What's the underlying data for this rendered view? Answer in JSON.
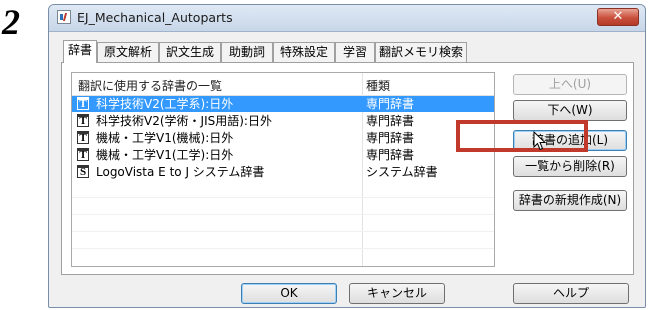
{
  "step_number": "2",
  "window": {
    "title": "EJ_Mechanical_Autoparts",
    "close_glyph": "✕"
  },
  "tabs": [
    {
      "label": "辞書",
      "active": true
    },
    {
      "label": "原文解析",
      "active": false
    },
    {
      "label": "訳文生成",
      "active": false
    },
    {
      "label": "助動詞",
      "active": false
    },
    {
      "label": "特殊設定",
      "active": false
    },
    {
      "label": "学習",
      "active": false
    },
    {
      "label": "翻訳メモリ検索",
      "active": false
    }
  ],
  "dictionary_list": {
    "columns": [
      "翻訳に使用する辞書の一覧",
      "種類"
    ],
    "rows": [
      {
        "icon": "T",
        "name": "科学技術V2(工学系):日外",
        "type": "専門辞書",
        "selected": true
      },
      {
        "icon": "T",
        "name": "科学技術V2(学術・JIS用語):日外",
        "type": "専門辞書",
        "selected": false
      },
      {
        "icon": "T",
        "name": "機械・工学V1(機械):日外",
        "type": "専門辞書",
        "selected": false
      },
      {
        "icon": "T",
        "name": "機械・工学V1(工学):日外",
        "type": "専門辞書",
        "selected": false
      },
      {
        "icon": "S",
        "name": "LogoVista E to J システム辞書",
        "type": "システム辞書",
        "selected": false
      }
    ]
  },
  "side_buttons": {
    "move_up": "上へ(U)",
    "move_down": "下へ(W)",
    "add_dictionary": "辞書の追加(L)",
    "remove_from_list": "一覧から削除(R)",
    "create_new_dictionary": "辞書の新規作成(N)"
  },
  "bottom_buttons": {
    "ok": "OK",
    "cancel": "キャンセル",
    "help": "ヘルプ"
  },
  "colors": {
    "selection": "#3399ff",
    "highlight_box": "#c0392b"
  }
}
